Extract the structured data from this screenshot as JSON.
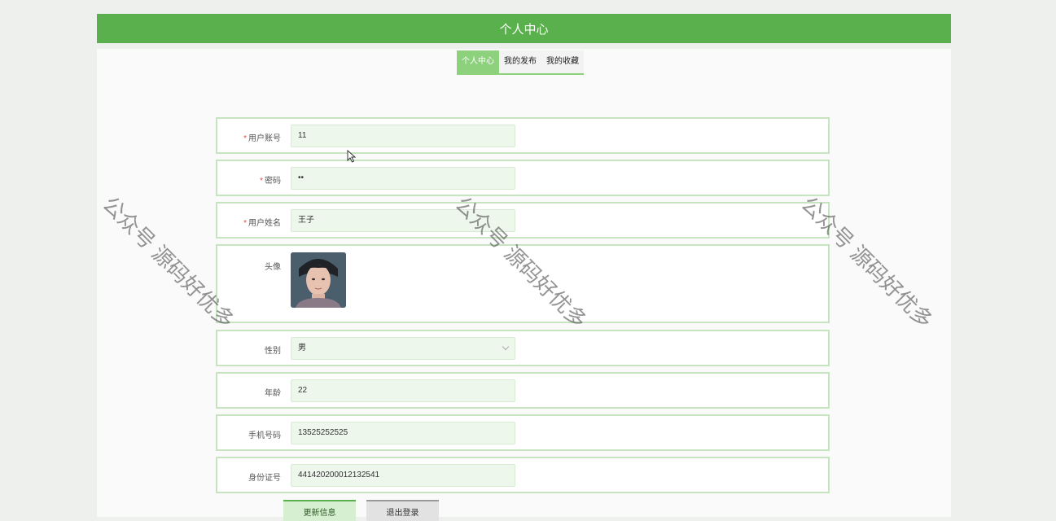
{
  "header": {
    "title": "个人中心"
  },
  "tabs": [
    {
      "label": "个人中心"
    },
    {
      "label": "我的发布"
    },
    {
      "label": "我的收藏"
    }
  ],
  "form": {
    "account": {
      "label": "用户账号",
      "value": "11",
      "required": true
    },
    "password": {
      "label": "密码",
      "value": "••",
      "required": true
    },
    "name": {
      "label": "用户姓名",
      "value": "王子",
      "required": true
    },
    "avatar": {
      "label": "头像"
    },
    "gender": {
      "label": "性别",
      "value": "男"
    },
    "age": {
      "label": "年龄",
      "value": "22"
    },
    "phone": {
      "label": "手机号码",
      "value": "13525252525"
    },
    "idcard": {
      "label": "身份证号",
      "value": "441420200012132541"
    }
  },
  "buttons": {
    "update": "更新信息",
    "logout": "退出登录"
  },
  "watermark": "公众号 源码好优多",
  "colors": {
    "accent": "#5ab04c",
    "tab_active": "#8dd17d",
    "row_border": "#c6e4c0"
  }
}
